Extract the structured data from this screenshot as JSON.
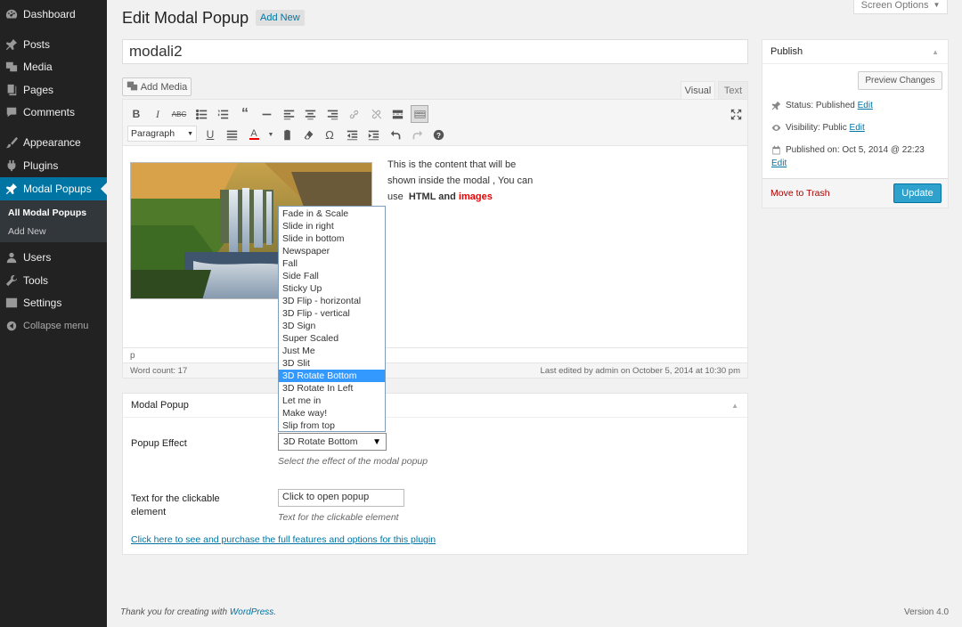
{
  "menu": {
    "items": [
      {
        "label": "Dashboard",
        "icon": "dashboard-icon"
      },
      {
        "label": "Posts",
        "icon": "pin-icon"
      },
      {
        "label": "Media",
        "icon": "media-icon"
      },
      {
        "label": "Pages",
        "icon": "pages-icon"
      },
      {
        "label": "Comments",
        "icon": "comment-icon"
      },
      {
        "label": "Appearance",
        "icon": "brush-icon"
      },
      {
        "label": "Plugins",
        "icon": "plugin-icon"
      },
      {
        "label": "Modal Popups",
        "icon": "pin-icon"
      },
      {
        "label": "Users",
        "icon": "user-icon"
      },
      {
        "label": "Tools",
        "icon": "wrench-icon"
      },
      {
        "label": "Settings",
        "icon": "settings-icon"
      }
    ],
    "submenu": [
      "All Modal Popups",
      "Add New"
    ],
    "collapse": "Collapse menu"
  },
  "header": {
    "title": "Edit Modal Popup",
    "add_new": "Add New",
    "screen_options": "Screen Options"
  },
  "post": {
    "title": "modali2"
  },
  "editor": {
    "add_media": "Add Media",
    "tab_visual": "Visual",
    "tab_text": "Text",
    "format": "Paragraph",
    "content_line1": "This is the content that will be",
    "content_line2": "shown inside the modal , You can",
    "content_line3_a": "use",
    "content_line3_b": "HTML and",
    "content_line3_c": "images",
    "path": "p",
    "word_count": "Word count: 17",
    "last_edited": "Last edited by admin on October 5, 2014 at 10:30 pm"
  },
  "modal_box": {
    "title": "Modal Popup",
    "effect_label": "Popup Effect",
    "effect_value": "3D Rotate Bottom",
    "effect_hint": "Select the effect of the modal popup",
    "text_label_1": "Text for the clickable",
    "text_label_2": "element",
    "text_value": "Click to open popup",
    "text_hint": "Text for the clickable element",
    "link": "Click here to see and purchase the full features and options for this plugin",
    "options": [
      "Fade in & Scale",
      "Slide in right",
      "Slide in bottom",
      "Newspaper",
      "Fall",
      "Side Fall",
      "Sticky Up",
      "3D Flip - horizontal",
      "3D Flip - vertical",
      "3D Sign",
      "Super Scaled",
      "Just Me",
      "3D Slit",
      "3D Rotate Bottom",
      "3D Rotate In Left",
      "Let me in",
      "Make way!",
      "Slip from top"
    ],
    "selected_index": 13
  },
  "publish": {
    "title": "Publish",
    "preview": "Preview Changes",
    "status_label": "Status:",
    "status_value": "Published",
    "visibility_label": "Visibility:",
    "visibility_value": "Public",
    "published_label": "Published on:",
    "published_value": "Oct 5, 2014 @ 22:23",
    "edit": "Edit",
    "trash": "Move to Trash",
    "update": "Update"
  },
  "footer": {
    "thanks": "Thank you for creating with",
    "wp": "WordPress",
    "version": "Version 4.0"
  },
  "colors": {
    "menu_bg": "#222222",
    "accent": "#0074a2",
    "update_btn": "#2ea2cc",
    "dropdown_selected": "#3399ff",
    "trash": "#aa0000"
  }
}
